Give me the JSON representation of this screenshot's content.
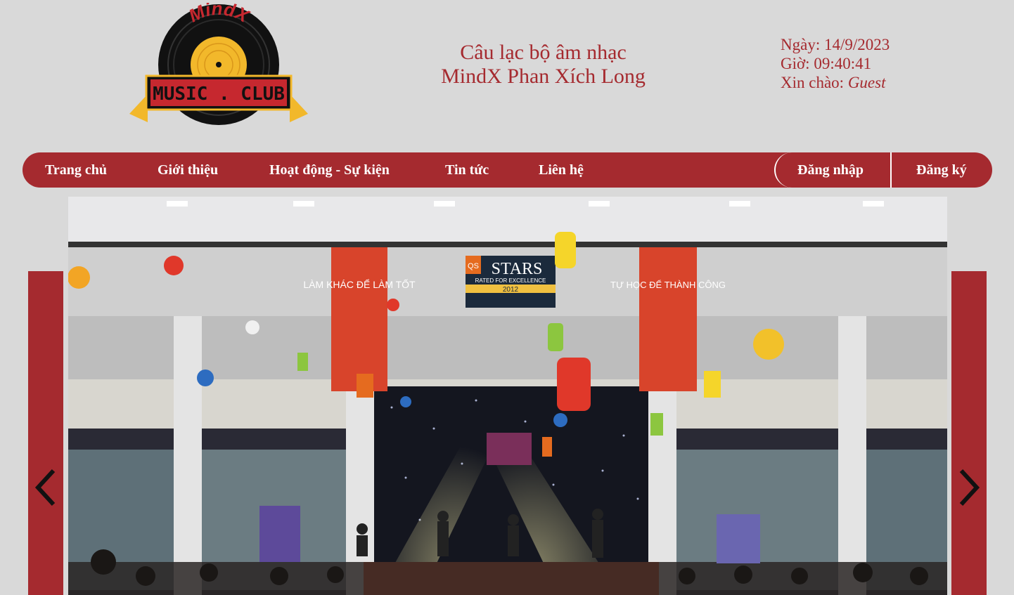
{
  "header": {
    "logo": {
      "arc_text": "MindX",
      "banner_text": "MUSIC . CLUB"
    },
    "title_line1": "Câu lạc bộ âm nhạc",
    "title_line2": "MindX Phan Xích Long",
    "date_label": "Ngày:",
    "date_value": "14/9/2023",
    "time_label": "Giờ:",
    "time_value": "09:40:41",
    "greeting_label": "Xin chào:",
    "greeting_user": "Guest"
  },
  "nav": {
    "items": [
      {
        "label": "Trang chủ"
      },
      {
        "label": "Giới thiệu"
      },
      {
        "label": "Hoạt động - Sự kiện"
      },
      {
        "label": "Tin tức"
      },
      {
        "label": "Liên hệ"
      }
    ],
    "login": "Đăng nhập",
    "register": "Đăng ký"
  },
  "slider": {
    "prev_icon": "chevron-left-icon",
    "next_icon": "chevron-right-icon",
    "photo": {
      "banner_left": "LÀM KHÁC ĐỂ LÀM TỐT",
      "banner_right": "TỰ HỌC ĐỂ THÀNH CÔNG",
      "qs_prefix": "QS",
      "qs_title": "STARS",
      "qs_sub": "RATED FOR EXCELLENCE",
      "qs_year": "2012"
    }
  },
  "colors": {
    "accent": "#a52a2f",
    "background": "#d9d9d9",
    "gold": "#f2b82b"
  }
}
